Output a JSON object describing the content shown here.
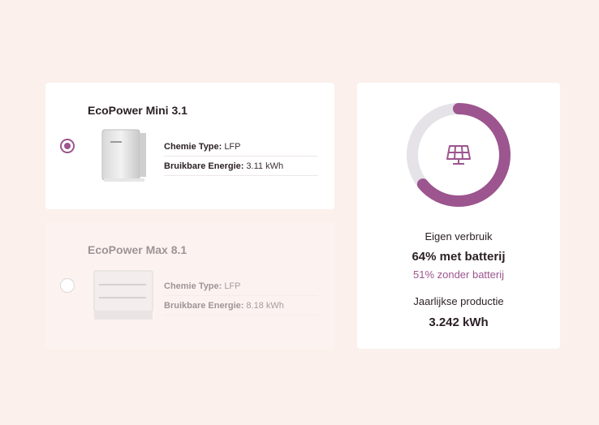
{
  "colors": {
    "accent": "#9c558f",
    "track": "#e5e3e8",
    "background": "#fbf0ec"
  },
  "products": [
    {
      "name": "EcoPower Mini 3.1",
      "selected": true,
      "chemistry_label": "Chemie Type:",
      "chemistry_value": "LFP",
      "energy_label": "Bruikbare Energie:",
      "energy_value": "3.11 kWh"
    },
    {
      "name": "EcoPower Max 8.1",
      "selected": false,
      "chemistry_label": "Chemie Type:",
      "chemistry_value": "LFP",
      "energy_label": "Bruikbare Energie:",
      "energy_value": "8.18 kWh"
    }
  ],
  "results": {
    "icon": "solar-panel-icon",
    "self_consumption_percent": 64,
    "own_use_label": "Eigen verbruik",
    "with_battery": "64% met batterij",
    "without_battery": "51% zonder batterij",
    "production_label": "Jaarlijkse productie",
    "production_value": "3.242 kWh"
  }
}
